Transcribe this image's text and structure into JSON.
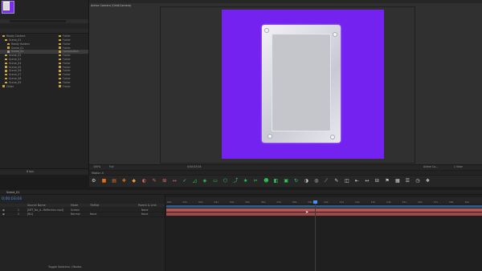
{
  "project": {
    "info_lines": [
      "",
      "",
      "",
      ""
    ],
    "items": [
      {
        "name": "Ready Content",
        "type": "Folder",
        "kind": "folder",
        "indent": 0,
        "selected": false
      },
      {
        "name": "Scene_01",
        "type": "Folder",
        "kind": "folder",
        "indent": 1,
        "selected": false
      },
      {
        "name": "Ready Holders",
        "type": "Folder",
        "kind": "folder",
        "indent": 2,
        "selected": false
      },
      {
        "name": "Scene_01",
        "type": "Folder",
        "kind": "folder",
        "indent": 2,
        "selected": false
      },
      {
        "name": "Scene_01",
        "type": "Composition",
        "kind": "comp",
        "indent": 2,
        "selected": true
      },
      {
        "name": "Scene_02",
        "type": "Folder",
        "kind": "folder",
        "indent": 1,
        "selected": false
      },
      {
        "name": "Scene_03",
        "type": "Folder",
        "kind": "folder",
        "indent": 1,
        "selected": false
      },
      {
        "name": "Scene_04",
        "type": "Folder",
        "kind": "folder",
        "indent": 1,
        "selected": false
      },
      {
        "name": "Scene_05",
        "type": "Folder",
        "kind": "folder",
        "indent": 1,
        "selected": false
      },
      {
        "name": "Scene_06",
        "type": "Folder",
        "kind": "folder",
        "indent": 1,
        "selected": false
      },
      {
        "name": "Scene_07",
        "type": "Folder",
        "kind": "folder",
        "indent": 1,
        "selected": false
      },
      {
        "name": "Scene_08",
        "type": "Folder",
        "kind": "folder",
        "indent": 1,
        "selected": false
      },
      {
        "name": "Scene_09",
        "type": "Folder",
        "kind": "folder",
        "indent": 1,
        "selected": false
      },
      {
        "name": "Other",
        "type": "Folder",
        "kind": "folder",
        "indent": 0,
        "selected": false
      }
    ],
    "bpc": "8 bpc"
  },
  "viewer": {
    "camera_label": "Active Camera (OrbitCamera)",
    "zoom": "100%",
    "quality": "Full",
    "timecode": "0;00;03;04",
    "camera_select": "Active Ca...",
    "views": "1 View"
  },
  "toolbar": {
    "tab_label": "Motion 4",
    "tools": [
      {
        "glyph": "⚙",
        "color": "#cfcfcf",
        "name": "settings-icon"
      },
      {
        "glyph": "■",
        "color": "#e0701f",
        "name": "file-icon"
      },
      {
        "glyph": "▤",
        "color": "#e0701f",
        "name": "grid-icon"
      },
      {
        "glyph": "✚",
        "color": "#e0701f",
        "name": "anchor-icon"
      },
      {
        "glyph": "◆",
        "color": "#e5a03a",
        "name": "keyframe-icon"
      },
      {
        "glyph": "◐",
        "color": "#e26b6b",
        "name": "ease-icon"
      },
      {
        "glyph": "✎",
        "color": "#e26b6b",
        "name": "pen-icon"
      },
      {
        "glyph": "⊞",
        "color": "#e26b6b",
        "name": "align-icon"
      },
      {
        "glyph": "↔",
        "color": "#e26b6b",
        "name": "flip-icon"
      },
      {
        "glyph": "✓",
        "color": "#2dd55b",
        "name": "check-icon"
      },
      {
        "glyph": "◿",
        "color": "#2dd55b",
        "name": "trim-icon"
      },
      {
        "glyph": "◈",
        "color": "#2dd55b",
        "name": "mask-icon"
      },
      {
        "glyph": "▭",
        "color": "#2dd55b",
        "name": "rect-icon"
      },
      {
        "glyph": "⬡",
        "color": "#2dd55b",
        "name": "shape-icon"
      },
      {
        "glyph": "⤴",
        "color": "#2dd55b",
        "name": "path-icon"
      },
      {
        "glyph": "★",
        "color": "#2dd55b",
        "name": "star-icon"
      },
      {
        "glyph": "✂",
        "color": "#2dd55b",
        "name": "cut-icon"
      },
      {
        "glyph": "☻",
        "color": "#2dd55b",
        "name": "null-icon"
      },
      {
        "glyph": "◧",
        "color": "#2dd55b",
        "name": "matte-icon"
      },
      {
        "glyph": "▣",
        "color": "#2dd55b",
        "name": "precomp-icon"
      },
      {
        "glyph": "↻",
        "color": "#2dd55b",
        "name": "loop-icon"
      },
      {
        "glyph": "◑",
        "color": "#cfcfcf",
        "name": "contrast-icon"
      },
      {
        "glyph": "◎",
        "color": "#cfcfcf",
        "name": "target-icon"
      },
      {
        "glyph": "⟋",
        "color": "#cfcfcf",
        "name": "line-icon"
      },
      {
        "glyph": "✎",
        "color": "#cfcfcf",
        "name": "edit-icon"
      },
      {
        "glyph": "◫",
        "color": "#cfcfcf",
        "name": "split-icon"
      },
      {
        "glyph": "⇤",
        "color": "#cfcfcf",
        "name": "snap-icon"
      },
      {
        "glyph": "↔",
        "color": "#cfcfcf",
        "name": "distribute-icon"
      },
      {
        "glyph": "⊟",
        "color": "#cfcfcf",
        "name": "box-icon"
      },
      {
        "glyph": "⚑",
        "color": "#cfcfcf",
        "name": "marker-icon"
      },
      {
        "glyph": "▦",
        "color": "#cfcfcf",
        "name": "layers-icon"
      },
      {
        "glyph": "☰",
        "color": "#cfcfcf",
        "name": "list-icon"
      },
      {
        "glyph": "◷",
        "color": "#cfcfcf",
        "name": "time-icon"
      },
      {
        "glyph": "❖",
        "color": "#cfcfcf",
        "name": "plugin-icon"
      }
    ]
  },
  "timeline": {
    "tab_label": "Scene_01",
    "timecode": "0;00;03;04",
    "columns": {
      "source": "Source Name",
      "mode": "Mode",
      "trkmat": "TrkMat",
      "parent": "Parent & Link"
    },
    "layers": [
      {
        "num": "1",
        "name": "[NFT_No_d...Reflection.mp4]",
        "mode": "Screen",
        "trkmat": "",
        "parent": "None"
      },
      {
        "num": "2",
        "name": "[BG]",
        "mode": "Normal",
        "trkmat": "None",
        "parent": "None"
      }
    ],
    "ruler": [
      "00s",
      "01s",
      "02s",
      "03s",
      "04s",
      "05s",
      "06s",
      "07s",
      "08s",
      "09s",
      "10s",
      "11s",
      "12s",
      "13s",
      "14s",
      "15s",
      "16s",
      "17s",
      "18s",
      "19s"
    ],
    "toggle_label": "Toggle Switches / Modes"
  },
  "colors": {
    "accent": "#4d8ef0",
    "purple_bg": "#7422ef",
    "layer1": "#b55656",
    "layer2": "#a34848"
  }
}
